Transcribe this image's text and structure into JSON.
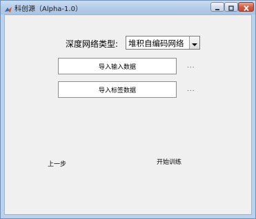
{
  "window": {
    "title": "科创源（Alpha-1.0）",
    "controls": {
      "minimize": "minimize-icon",
      "maximize": "maximize-icon",
      "close": "close-icon"
    }
  },
  "form": {
    "network_type_label": "深度网络类型:",
    "network_type_value": "堆积自编码网络",
    "import_input_button": "导入输入数据",
    "import_input_path": "...",
    "import_label_button": "导入标签数据",
    "import_label_path": "...",
    "prev_button": "上一步",
    "train_button": "开始训练"
  },
  "colors": {
    "title_bar": "#b9d1ea",
    "client_bg": "#f0f0f0",
    "close_button": "#c94f38"
  }
}
